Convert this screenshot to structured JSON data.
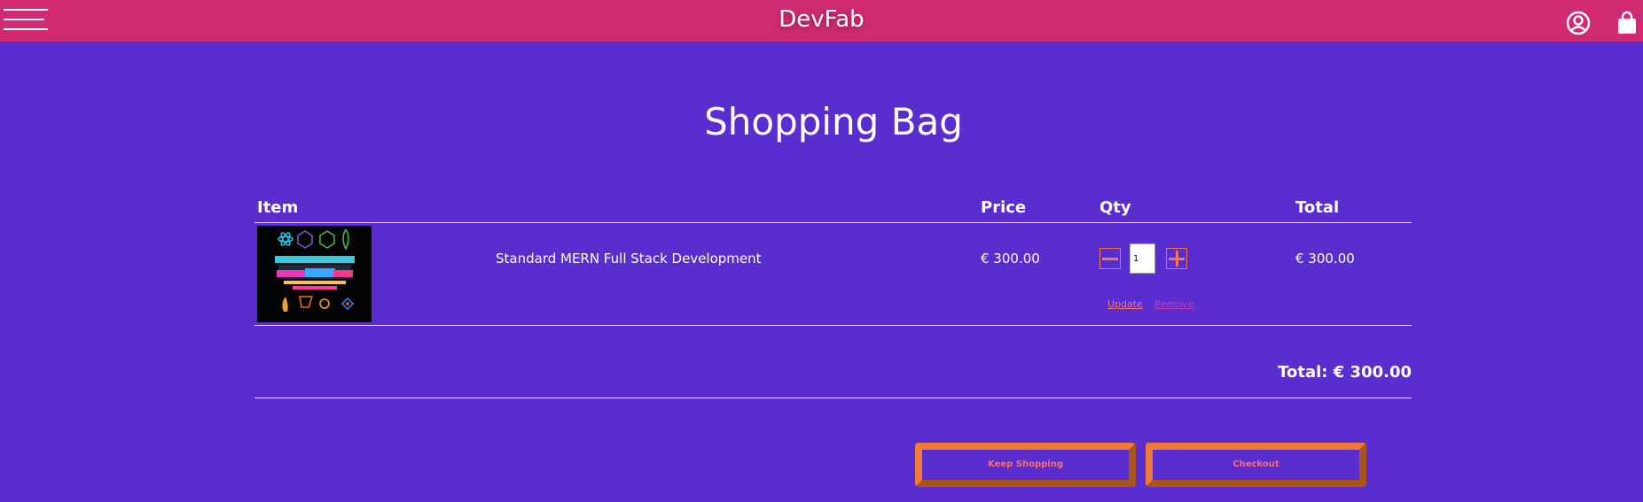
{
  "header": {
    "brand": "DevFab"
  },
  "page": {
    "title": "Shopping Bag"
  },
  "table": {
    "headers": {
      "item": "Item",
      "price": "Price",
      "qty": "Qty",
      "total": "Total"
    },
    "rows": [
      {
        "name": "Standard MERN Full Stack Development",
        "price": "€ 300.00",
        "qty": "1",
        "total": "€ 300.00",
        "update_label": "Update",
        "remove_label": "Remove"
      }
    ]
  },
  "summary": {
    "total_label": "Total: € 300.00"
  },
  "actions": {
    "keep_shopping": "Keep Shopping",
    "checkout": "Checkout"
  },
  "colors": {
    "header_bg": "#cf2a72",
    "page_bg": "#5a2dcf",
    "accent": "#f07a3a",
    "link": "#f36f78"
  }
}
